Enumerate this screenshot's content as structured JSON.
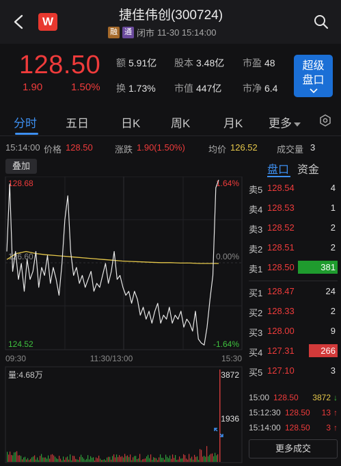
{
  "header": {
    "logo_letter": "W",
    "title": "捷佳伟创(300724)",
    "tag_rong": "融",
    "tag_tong": "通",
    "status": "闭市",
    "datetime": "11-30 15:14:00",
    "icons": [
      "back-arrow-icon",
      "search-icon"
    ]
  },
  "quote": {
    "price": "128.50",
    "change": "1.90",
    "change_pct": "1.50%",
    "turnover_label": "额",
    "turnover": "5.91亿",
    "share_capital_label": "股本",
    "share_capital": "3.48亿",
    "pe_label": "市盈",
    "pe": "48",
    "turnover_rate_label": "换",
    "turnover_rate": "1.73%",
    "market_cap_label": "市值",
    "market_cap": "447亿",
    "pb_label": "市净",
    "pb": "6.4",
    "super_btn_line1": "超级",
    "super_btn_line2": "盘口",
    "colors": {
      "up": "#ef3b3b",
      "down": "#3ec23e",
      "accent": "#3d8ff0",
      "avg_line": "#e6c84a"
    }
  },
  "tabs": [
    "分时",
    "五日",
    "日K",
    "周K",
    "月K",
    "更多"
  ],
  "info_row": {
    "time": "15:14:00",
    "price_label": "价格",
    "price": "128.50",
    "chg_label": "涨跌",
    "chg": "1.90(1.50%)",
    "avg_label": "均价",
    "avg": "126.52",
    "vol_label": "成交量",
    "vol": "3"
  },
  "overlay_btn": "叠加",
  "side_tabs": [
    "盘口",
    "资金"
  ],
  "chart_data": {
    "type": "line",
    "series": [],
    "y_labels": {
      "high": "128.68",
      "low": "124.52",
      "high_pct": "1.64%",
      "low_pct": "-1.64%",
      "zero_pct": "0.00%",
      "mid": "126.60"
    },
    "x_labels": [
      "09:30",
      "11:30/13:00",
      "15:30"
    ],
    "price": [
      126.9,
      128.6,
      126.4,
      126.9,
      126.2,
      126.6,
      125.9,
      126.7,
      126.2,
      126.4,
      126.9,
      126.0,
      126.5,
      126.3,
      126.8,
      126.1,
      126.5,
      126.2,
      125.8,
      126.6,
      127.7,
      128.3,
      126.9,
      126.3,
      126.5,
      126.1,
      126.3,
      126.0,
      126.2,
      126.4,
      125.9,
      126.1,
      126.0,
      126.3,
      126.6,
      126.1,
      126.4,
      126.9,
      126.2,
      126.3,
      126.0,
      125.8,
      125.9,
      125.6,
      125.9,
      125.7,
      125.3,
      125.5,
      125.2,
      125.4,
      125.1,
      125.4,
      125.6,
      125.1,
      125.3,
      125.2,
      125.5,
      125.1,
      125.3,
      125.2,
      125.4,
      125.0,
      125.2,
      125.1,
      124.9,
      125.4,
      124.7,
      124.6,
      124.55,
      125.0,
      125.7,
      126.3,
      128.5,
      128.7
    ],
    "avg": [
      126.7,
      126.85,
      126.9,
      126.85,
      126.82,
      126.8,
      126.78,
      126.76,
      126.74,
      126.72,
      126.7,
      126.68,
      126.66,
      126.65,
      126.64,
      126.63,
      126.62,
      126.62,
      126.61,
      126.61,
      126.6,
      126.6,
      126.6
    ],
    "volume_labels": {
      "total": "量:4.68万",
      "max": "3872",
      "mid": "1936"
    }
  },
  "order_book": {
    "asks": [
      {
        "label": "卖5",
        "price": "128.54",
        "vol": "4"
      },
      {
        "label": "卖4",
        "price": "128.53",
        "vol": "1"
      },
      {
        "label": "卖3",
        "price": "128.52",
        "vol": "2"
      },
      {
        "label": "卖2",
        "price": "128.51",
        "vol": "2"
      },
      {
        "label": "卖1",
        "price": "128.50",
        "vol": "381"
      }
    ],
    "bids": [
      {
        "label": "买1",
        "price": "128.47",
        "vol": "24"
      },
      {
        "label": "买2",
        "price": "128.33",
        "vol": "2"
      },
      {
        "label": "买3",
        "price": "128.00",
        "vol": "9"
      },
      {
        "label": "买4",
        "price": "127.31",
        "vol": "266"
      },
      {
        "label": "买5",
        "price": "127.10",
        "vol": "3"
      }
    ]
  },
  "trades": [
    {
      "time": "15:00",
      "price": "128.50",
      "vol": "3872",
      "dir": "↓"
    },
    {
      "time": "15:12:30",
      "price": "128.50",
      "vol": "13",
      "dir": "↑"
    },
    {
      "time": "15:14:00",
      "price": "128.50",
      "vol": "3",
      "dir": "↑"
    }
  ],
  "more_trades": "更多成交"
}
